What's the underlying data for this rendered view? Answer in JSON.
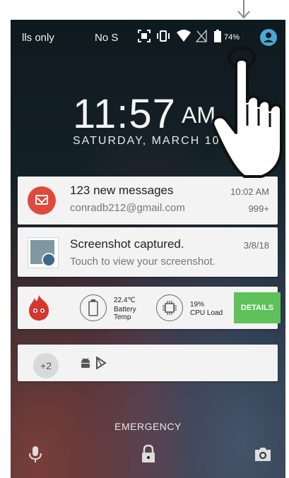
{
  "status_bar": {
    "carrier_left": "lls only",
    "carrier_right": "No S",
    "battery": "74%"
  },
  "lockscreen": {
    "time": "11:57",
    "ampm": "AM",
    "date": "SATURDAY, MARCH 10"
  },
  "notifications": {
    "gmail": {
      "title": "123 new messages",
      "account": "conradb212@gmail.com",
      "time": "10:02 AM",
      "count": "999+"
    },
    "screenshot": {
      "title": "Screenshot captured.",
      "subtitle": "Touch to view your screenshot.",
      "date": "3/8/18"
    },
    "antutu": {
      "battery_temp": "22.4℃",
      "battery_label_1": "Battery",
      "battery_label_2": "Temp",
      "cpu_load": "19%",
      "cpu_label": "CPU Load",
      "details_button": "DETAILS"
    },
    "more": {
      "count": "+2"
    }
  },
  "bottom": {
    "emergency": "EMERGENCY"
  },
  "colors": {
    "gmail_red": "#e04a3a",
    "details_green": "#5ec15a",
    "card_bg": "#f3f3f3"
  }
}
